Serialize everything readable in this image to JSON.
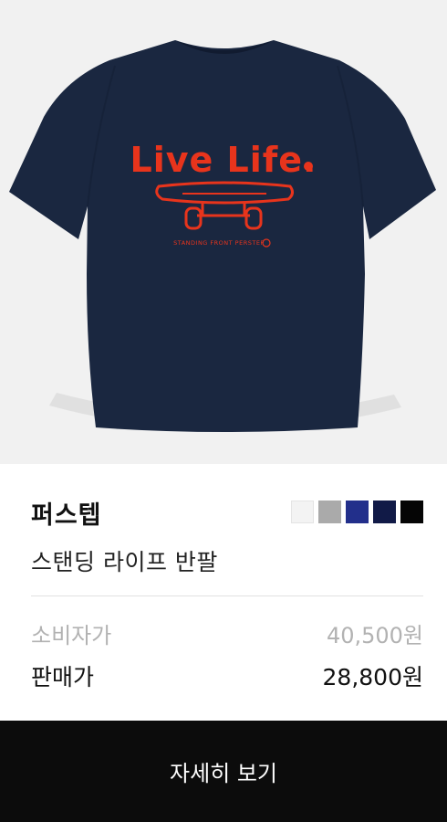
{
  "product": {
    "image_alt": "navy short sleeve t-shirt with red Live Life print",
    "print_title": "Live Life.",
    "print_caption": "STANDING FRONT PERSTEP",
    "brand": "퍼스텝",
    "name": "스탠딩 라이프 반팔",
    "color_options": [
      {
        "name": "white",
        "hex": "#f3f3f3"
      },
      {
        "name": "gray",
        "hex": "#aaaaaa"
      },
      {
        "name": "royal-blue",
        "hex": "#222f8b"
      },
      {
        "name": "navy",
        "hex": "#111a47"
      },
      {
        "name": "black",
        "hex": "#050505"
      }
    ]
  },
  "price": {
    "retail_label": "소비자가",
    "retail_value": "40,500원",
    "sale_label": "판매가",
    "sale_value": "28,800원"
  },
  "action": {
    "detail_label": "자세히 보기"
  },
  "colors": {
    "shirt": "#1a2740",
    "print": "#e8341c",
    "background": "#f1f1f1",
    "button": "#0c0c0c"
  }
}
